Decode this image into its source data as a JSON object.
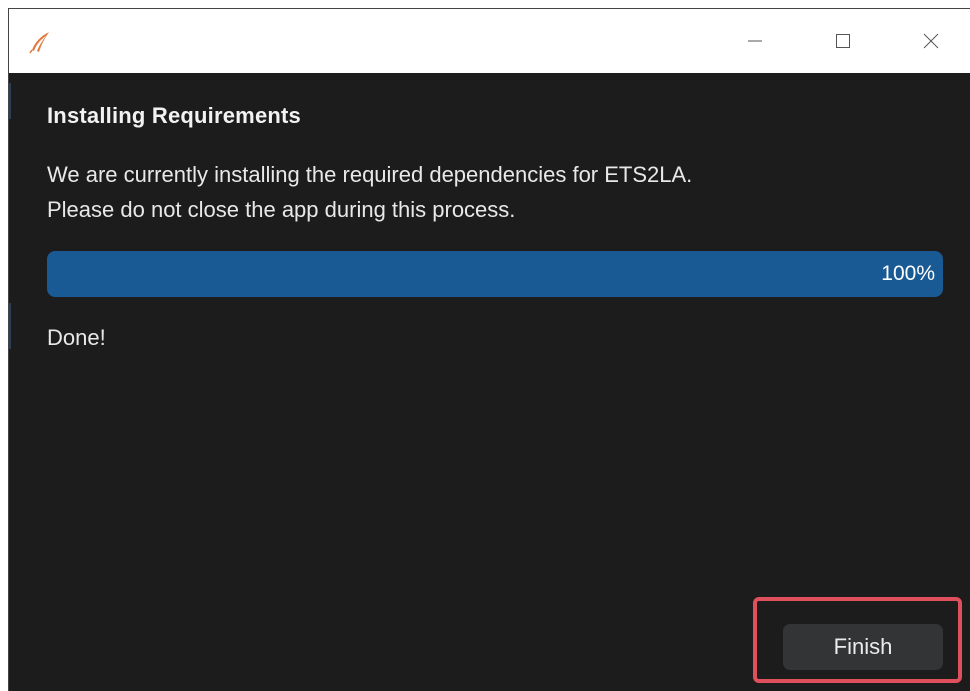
{
  "window": {
    "icon": "feather-logo-icon",
    "accent_icon_color": "#e0783c",
    "controls": {
      "minimize": "minimize-icon",
      "maximize": "maximize-icon",
      "close": "close-icon"
    }
  },
  "main": {
    "heading": "Installing Requirements",
    "description_line1": "We are currently installing the required dependencies for ETS2LA.",
    "description_line2": "Please do not close the app during this process.",
    "progress": {
      "value": 1.0,
      "label": "100%",
      "fill_color": "#1a5a94"
    },
    "status": "Done!",
    "finish_label": "Finish",
    "highlight_color": "#e0505c"
  }
}
